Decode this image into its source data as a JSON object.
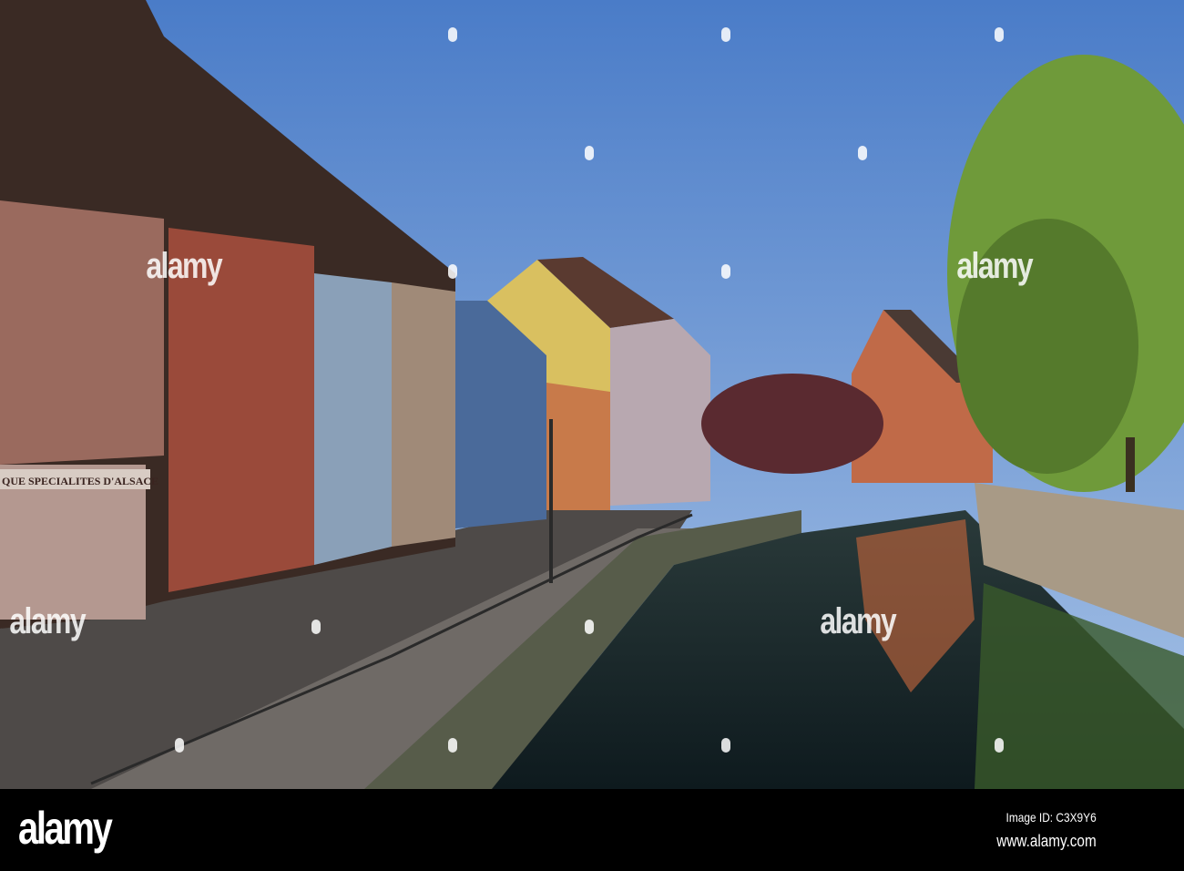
{
  "photo": {
    "description_subject": "canal street",
    "shop_sign": "QUE SPECIALITES D'ALSACE",
    "colors": {
      "sky_top": "#4f7fc8",
      "sky_bottom": "#a9c2e4",
      "tree": "#6f9a3a",
      "water": "#1a2a2a",
      "bar": "#000000"
    }
  },
  "watermark": {
    "text": "alamy"
  },
  "footer": {
    "logo": "alamy",
    "image_id": "Image ID: C3X9Y6",
    "website": "www.alamy.com"
  }
}
